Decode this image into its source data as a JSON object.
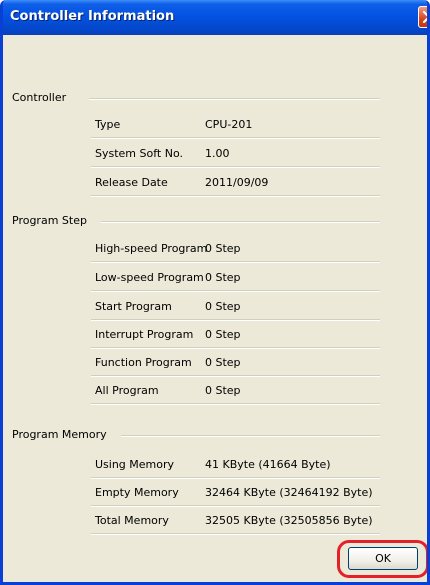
{
  "window": {
    "title": "Controller Information"
  },
  "controller": {
    "heading": "Controller",
    "rows": [
      {
        "label": "Type",
        "value": "CPU-201"
      },
      {
        "label": "System Soft No.",
        "value": "1.00"
      },
      {
        "label": "Release Date",
        "value": "2011/09/09"
      }
    ]
  },
  "program_step": {
    "heading": "Program Step",
    "rows": [
      {
        "label": "High-speed Program",
        "value": "0 Step"
      },
      {
        "label": "Low-speed Program",
        "value": "0 Step"
      },
      {
        "label": "Start Program",
        "value": "0 Step"
      },
      {
        "label": "Interrupt Program",
        "value": "0 Step"
      },
      {
        "label": "Function Program",
        "value": "0 Step"
      },
      {
        "label": "All Program",
        "value": "0 Step"
      }
    ]
  },
  "program_memory": {
    "heading": "Program Memory",
    "rows": [
      {
        "label": "Using Memory",
        "value": "41 KByte (41664 Byte)"
      },
      {
        "label": "Empty Memory",
        "value": "32464 KByte (32464192 Byte)"
      },
      {
        "label": "Total Memory",
        "value": "32505 KByte (32505856 Byte)"
      }
    ]
  },
  "buttons": {
    "ok_label": "OK"
  },
  "colors": {
    "titlebar": "#0553e2",
    "highlight": "#e4202a",
    "dialog_bg": "#ece9d8"
  }
}
